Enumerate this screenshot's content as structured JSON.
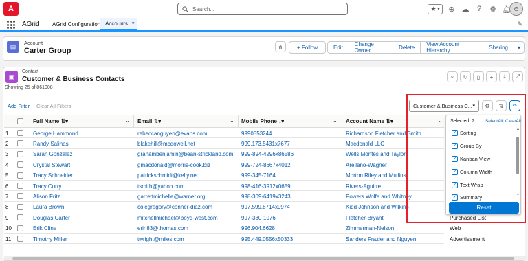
{
  "topbar": {
    "logo_text": "A",
    "search_placeholder": "Search...",
    "icons": [
      "star-icon",
      "chevron-down-icon",
      "add-icon",
      "trailhead-icon",
      "help-icon",
      "gear-icon",
      "bell-icon"
    ]
  },
  "nav": {
    "app_name": "AGrid",
    "tabs": [
      {
        "label": "AGrid Configuration"
      },
      {
        "label": "Accounts"
      }
    ]
  },
  "account": {
    "object_label": "Account",
    "name": "Carter Group",
    "buttons": {
      "follow": "+ Follow",
      "edit": "Edit",
      "change_owner": "Change Owner",
      "delete": "Delete",
      "view_hierarchy": "View Account Hierarchy",
      "sharing": "Sharing"
    }
  },
  "contacts": {
    "object_label": "Contact",
    "title": "Customer & Business Contacts",
    "showing": "Showing 25 of 861008",
    "add_filter": "Add Filter",
    "clear_filters": "Clear All Filters",
    "view_select": "Customer & Business C..."
  },
  "table": {
    "columns": [
      {
        "label": "Full Name"
      },
      {
        "label": "Email"
      },
      {
        "label": "Mobile Phone"
      },
      {
        "label": "Account Name"
      }
    ],
    "rows": [
      {
        "n": "1",
        "name": "George Hammond",
        "email": "rebeccanguyen@evans.com",
        "phone": "9990553244",
        "account": "Richardson Fletcher and Smith",
        "extra": ""
      },
      {
        "n": "2",
        "name": "Randy Salinas",
        "email": "blakehill@mcdowell.net",
        "phone": "999.173.5431x7677",
        "account": "Macdonald LLC",
        "extra": ""
      },
      {
        "n": "3",
        "name": "Sarah Gonzalez",
        "email": "grahambenjamin@bean-strickland.com",
        "phone": "999-894-4296x86586",
        "account": "Wells Montes and Taylor",
        "extra": ""
      },
      {
        "n": "4",
        "name": "Crystal Stewart",
        "email": "gmacdonald@morris-cook.biz",
        "phone": "999-724-8667x4012",
        "account": "Arellano-Wagner",
        "extra": ""
      },
      {
        "n": "5",
        "name": "Tracy Schneider",
        "email": "patrickschmidt@kelly.net",
        "phone": "999-345-7164",
        "account": "Morton Riley and Mullins",
        "extra": ""
      },
      {
        "n": "6",
        "name": "Tracy Curry",
        "email": "tsmith@yahoo.com",
        "phone": "998-416-3912x0659",
        "account": "Rivers-Aguirre",
        "extra": ""
      },
      {
        "n": "7",
        "name": "Alison Fritz",
        "email": "garrettmichelle@warner.org",
        "phone": "998-309-6419x3243",
        "account": "Powers Wolfe and Whitney",
        "extra": ""
      },
      {
        "n": "8",
        "name": "Laura Brown",
        "email": "colegregory@conner-diaz.com",
        "phone": "997.599.8714x9974",
        "account": "Kidd Johnson and Wilkins",
        "extra": ""
      },
      {
        "n": "9",
        "name": "Douglas Carter",
        "email": "mitchellmichael@boyd-west.com",
        "phone": "997-330-1076",
        "account": "Fletcher-Bryant",
        "extra": "Purchased List"
      },
      {
        "n": "10",
        "name": "Erik Cline",
        "email": "erin83@thomas.com",
        "phone": "996.904.6628",
        "account": "Zimmerman-Nelson",
        "extra": "Web"
      },
      {
        "n": "11",
        "name": "Timothy Miller",
        "email": "twright@miles.com",
        "phone": "995.449.0556x50333",
        "account": "Sanders Frazier and Nguyen",
        "extra": "Advertisement"
      }
    ]
  },
  "panel": {
    "selected_label": "Selected: 7",
    "select_all": "SelectAll",
    "divider": "|",
    "clear_all": "ClearAll",
    "options": [
      {
        "label": "Sorting"
      },
      {
        "label": "Group By"
      },
      {
        "label": "Kanban View"
      },
      {
        "label": "Column Width"
      },
      {
        "label": "Text Wrap"
      },
      {
        "label": "Summary"
      }
    ],
    "reset": "Reset"
  },
  "colors": {
    "brand_red": "#e3162b",
    "link": "#0b5cab",
    "primary": "#0176d3",
    "highlight_box": "#e3222b"
  }
}
